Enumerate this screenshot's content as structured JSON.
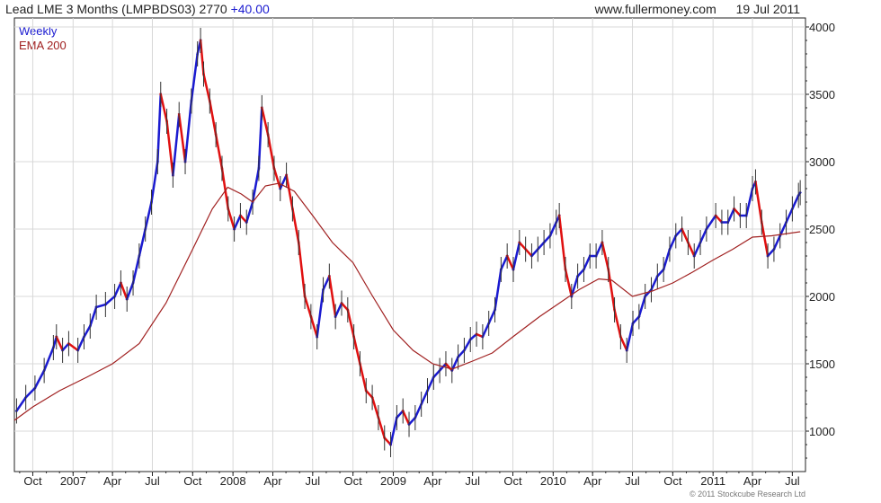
{
  "header": {
    "title": "Lead LME 3 Months (LMPBDS03)",
    "price": "2770",
    "change": "+40.00",
    "source": "www.fullermoney.com",
    "date": "19 Jul 2011"
  },
  "legend": {
    "series1": "Weekly",
    "series2": "EMA 200"
  },
  "copyright": "© 2011 Stockcube Research Ltd",
  "colors": {
    "up": "#1a1ad0",
    "down": "#e01010",
    "ema": "#a02020",
    "grid": "#d8d8d8"
  },
  "chart_data": {
    "type": "line",
    "title": "Lead LME 3 Months (LMPBDS03)",
    "ylim": [
      800,
      4000
    ],
    "yticks": [
      1000,
      1500,
      2000,
      2500,
      3000,
      3500,
      4000
    ],
    "x_tick_labels": [
      "Oct",
      "2007",
      "Apr",
      "Jul",
      "Oct",
      "2008",
      "Apr",
      "Jul",
      "Oct",
      "2009",
      "Apr",
      "Jul",
      "Oct",
      "2010",
      "Apr",
      "Jul",
      "Oct",
      "2011",
      "Apr",
      "Jul"
    ],
    "x_tick_dates": [
      "2006-10-01",
      "2007-01-01",
      "2007-04-01",
      "2007-07-01",
      "2007-10-01",
      "2008-01-01",
      "2008-04-01",
      "2008-07-01",
      "2008-10-01",
      "2009-01-01",
      "2009-04-01",
      "2009-07-01",
      "2009-10-01",
      "2010-01-01",
      "2010-04-01",
      "2010-07-01",
      "2010-10-01",
      "2011-01-01",
      "2011-04-01",
      "2011-07-01"
    ],
    "x_range": [
      "2006-08-20",
      "2011-07-31"
    ],
    "series": [
      {
        "name": "Weekly",
        "style": "candlestick-line",
        "points": [
          [
            "2006-08-25",
            1150
          ],
          [
            "2006-09-15",
            1250
          ],
          [
            "2006-10-06",
            1320
          ],
          [
            "2006-10-27",
            1450
          ],
          [
            "2006-11-17",
            1620
          ],
          [
            "2006-11-24",
            1700
          ],
          [
            "2006-12-08",
            1600
          ],
          [
            "2006-12-22",
            1650
          ],
          [
            "2007-01-12",
            1600
          ],
          [
            "2007-01-26",
            1700
          ],
          [
            "2007-02-09",
            1780
          ],
          [
            "2007-02-23",
            1920
          ],
          [
            "2007-03-16",
            1940
          ],
          [
            "2007-04-06",
            2000
          ],
          [
            "2007-04-20",
            2100
          ],
          [
            "2007-05-04",
            1980
          ],
          [
            "2007-05-18",
            2100
          ],
          [
            "2007-06-01",
            2300
          ],
          [
            "2007-06-15",
            2500
          ],
          [
            "2007-06-29",
            2700
          ],
          [
            "2007-07-13",
            3000
          ],
          [
            "2007-07-20",
            3500
          ],
          [
            "2007-08-03",
            3300
          ],
          [
            "2007-08-17",
            2900
          ],
          [
            "2007-08-31",
            3350
          ],
          [
            "2007-09-14",
            3000
          ],
          [
            "2007-09-28",
            3450
          ],
          [
            "2007-10-12",
            3800
          ],
          [
            "2007-10-19",
            3900
          ],
          [
            "2007-10-26",
            3650
          ],
          [
            "2007-11-09",
            3450
          ],
          [
            "2007-11-23",
            3200
          ],
          [
            "2007-12-07",
            2950
          ],
          [
            "2007-12-21",
            2650
          ],
          [
            "2008-01-04",
            2500
          ],
          [
            "2008-01-18",
            2600
          ],
          [
            "2008-02-01",
            2550
          ],
          [
            "2008-02-15",
            2700
          ],
          [
            "2008-02-29",
            2950
          ],
          [
            "2008-03-07",
            3400
          ],
          [
            "2008-03-21",
            3200
          ],
          [
            "2008-04-04",
            2950
          ],
          [
            "2008-04-18",
            2800
          ],
          [
            "2008-05-02",
            2900
          ],
          [
            "2008-05-16",
            2650
          ],
          [
            "2008-05-30",
            2400
          ],
          [
            "2008-06-13",
            2000
          ],
          [
            "2008-06-27",
            1850
          ],
          [
            "2008-07-11",
            1700
          ],
          [
            "2008-07-25",
            2050
          ],
          [
            "2008-08-08",
            2150
          ],
          [
            "2008-08-22",
            1850
          ],
          [
            "2008-09-05",
            1950
          ],
          [
            "2008-09-19",
            1900
          ],
          [
            "2008-10-03",
            1700
          ],
          [
            "2008-10-17",
            1500
          ],
          [
            "2008-10-31",
            1300
          ],
          [
            "2008-11-14",
            1250
          ],
          [
            "2008-11-28",
            1100
          ],
          [
            "2008-12-12",
            950
          ],
          [
            "2008-12-26",
            900
          ],
          [
            "2009-01-09",
            1100
          ],
          [
            "2009-01-23",
            1150
          ],
          [
            "2009-02-06",
            1050
          ],
          [
            "2009-02-20",
            1100
          ],
          [
            "2009-03-06",
            1200
          ],
          [
            "2009-03-20",
            1300
          ],
          [
            "2009-04-03",
            1400
          ],
          [
            "2009-04-17",
            1450
          ],
          [
            "2009-05-01",
            1500
          ],
          [
            "2009-05-15",
            1450
          ],
          [
            "2009-05-29",
            1550
          ],
          [
            "2009-06-12",
            1600
          ],
          [
            "2009-06-26",
            1680
          ],
          [
            "2009-07-10",
            1720
          ],
          [
            "2009-07-24",
            1700
          ],
          [
            "2009-08-07",
            1800
          ],
          [
            "2009-08-21",
            1900
          ],
          [
            "2009-09-04",
            2200
          ],
          [
            "2009-09-18",
            2300
          ],
          [
            "2009-10-02",
            2200
          ],
          [
            "2009-10-16",
            2400
          ],
          [
            "2009-10-30",
            2350
          ],
          [
            "2009-11-13",
            2300
          ],
          [
            "2009-11-27",
            2350
          ],
          [
            "2009-12-11",
            2400
          ],
          [
            "2009-12-25",
            2450
          ],
          [
            "2010-01-08",
            2550
          ],
          [
            "2010-01-15",
            2600
          ],
          [
            "2010-01-29",
            2200
          ],
          [
            "2010-02-12",
            2000
          ],
          [
            "2010-02-26",
            2150
          ],
          [
            "2010-03-12",
            2200
          ],
          [
            "2010-03-26",
            2300
          ],
          [
            "2010-04-09",
            2300
          ],
          [
            "2010-04-23",
            2400
          ],
          [
            "2010-05-07",
            2200
          ],
          [
            "2010-05-21",
            1900
          ],
          [
            "2010-06-04",
            1700
          ],
          [
            "2010-06-18",
            1600
          ],
          [
            "2010-07-02",
            1800
          ],
          [
            "2010-07-16",
            1850
          ],
          [
            "2010-07-30",
            2000
          ],
          [
            "2010-08-13",
            2050
          ],
          [
            "2010-08-27",
            2150
          ],
          [
            "2010-09-10",
            2200
          ],
          [
            "2010-09-24",
            2350
          ],
          [
            "2010-10-08",
            2450
          ],
          [
            "2010-10-22",
            2500
          ],
          [
            "2010-11-05",
            2400
          ],
          [
            "2010-11-19",
            2300
          ],
          [
            "2010-12-03",
            2400
          ],
          [
            "2010-12-17",
            2500
          ],
          [
            "2011-01-07",
            2600
          ],
          [
            "2011-01-21",
            2550
          ],
          [
            "2011-02-04",
            2550
          ],
          [
            "2011-02-18",
            2650
          ],
          [
            "2011-03-04",
            2600
          ],
          [
            "2011-03-18",
            2600
          ],
          [
            "2011-04-01",
            2800
          ],
          [
            "2011-04-08",
            2850
          ],
          [
            "2011-04-22",
            2550
          ],
          [
            "2011-05-06",
            2300
          ],
          [
            "2011-05-20",
            2350
          ],
          [
            "2011-06-03",
            2450
          ],
          [
            "2011-06-17",
            2550
          ],
          [
            "2011-07-01",
            2650
          ],
          [
            "2011-07-15",
            2750
          ],
          [
            "2011-07-19",
            2770
          ]
        ]
      },
      {
        "name": "EMA 200",
        "style": "line",
        "points": [
          [
            "2006-08-20",
            1080
          ],
          [
            "2006-10-01",
            1180
          ],
          [
            "2006-12-01",
            1300
          ],
          [
            "2007-02-01",
            1400
          ],
          [
            "2007-04-01",
            1500
          ],
          [
            "2007-06-01",
            1650
          ],
          [
            "2007-08-01",
            1950
          ],
          [
            "2007-10-01",
            2350
          ],
          [
            "2007-11-15",
            2650
          ],
          [
            "2007-12-20",
            2810
          ],
          [
            "2008-01-20",
            2760
          ],
          [
            "2008-02-15",
            2700
          ],
          [
            "2008-03-15",
            2820
          ],
          [
            "2008-04-15",
            2840
          ],
          [
            "2008-05-20",
            2780
          ],
          [
            "2008-07-01",
            2600
          ],
          [
            "2008-08-15",
            2400
          ],
          [
            "2008-10-01",
            2250
          ],
          [
            "2008-11-15",
            2000
          ],
          [
            "2009-01-01",
            1750
          ],
          [
            "2009-02-15",
            1600
          ],
          [
            "2009-04-01",
            1500
          ],
          [
            "2009-05-15",
            1460
          ],
          [
            "2009-07-01",
            1520
          ],
          [
            "2009-08-15",
            1580
          ],
          [
            "2009-10-01",
            1700
          ],
          [
            "2009-12-01",
            1850
          ],
          [
            "2010-01-15",
            1950
          ],
          [
            "2010-03-01",
            2050
          ],
          [
            "2010-04-15",
            2130
          ],
          [
            "2010-05-15",
            2120
          ],
          [
            "2010-07-01",
            2000
          ],
          [
            "2010-08-15",
            2040
          ],
          [
            "2010-10-01",
            2100
          ],
          [
            "2010-11-15",
            2180
          ],
          [
            "2011-01-01",
            2270
          ],
          [
            "2011-02-15",
            2350
          ],
          [
            "2011-04-01",
            2440
          ],
          [
            "2011-05-15",
            2450
          ],
          [
            "2011-07-19",
            2480
          ]
        ]
      }
    ]
  }
}
